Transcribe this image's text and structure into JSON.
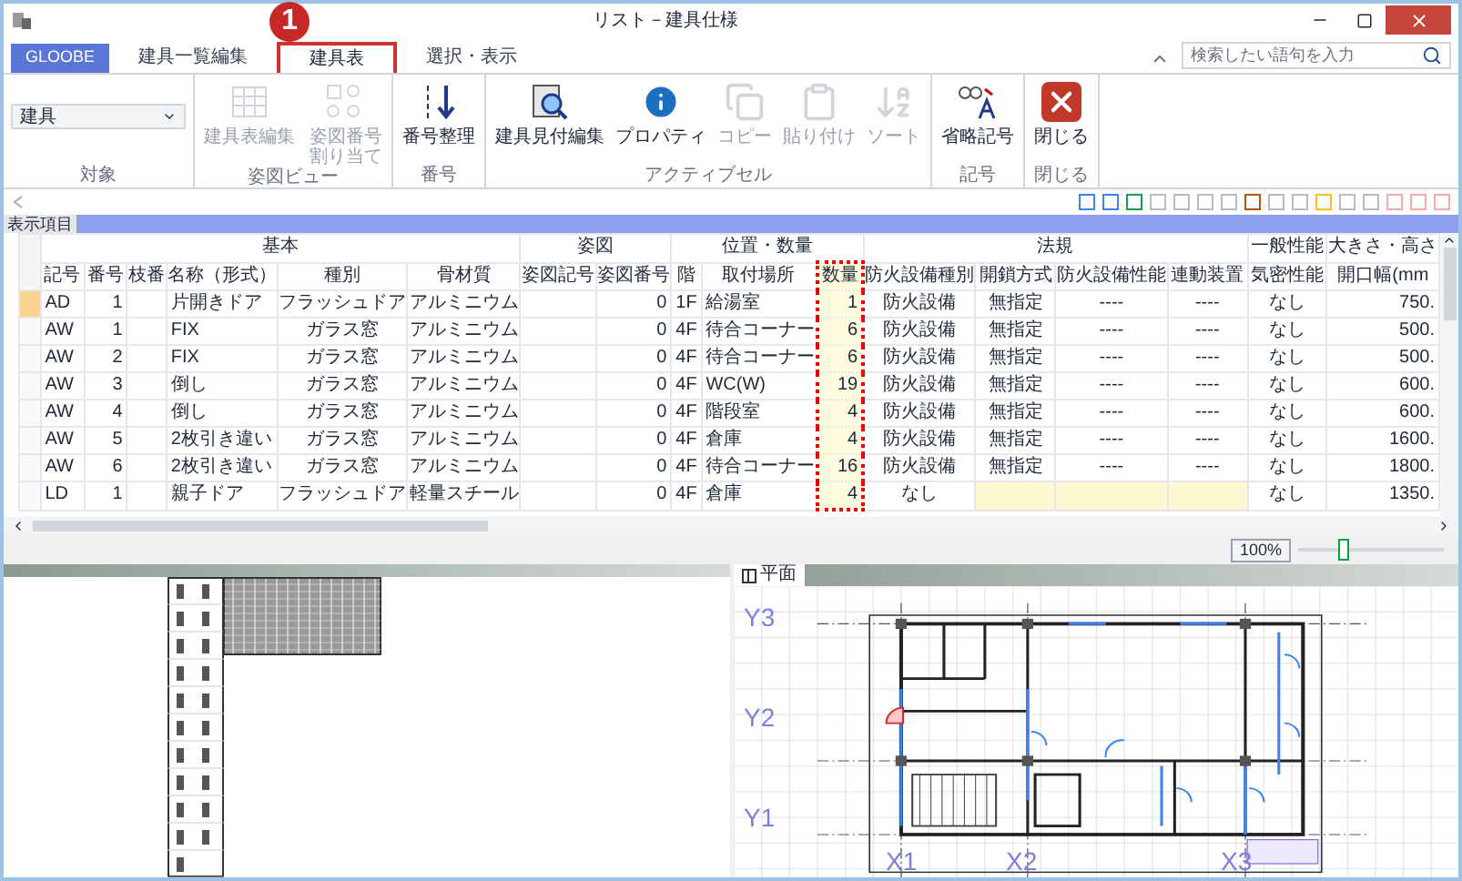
{
  "window": {
    "title": "リスト－建具仕様"
  },
  "app_button": {
    "label": "GLOOBE"
  },
  "tabs": [
    {
      "label": "建具一覧編集",
      "selected": false
    },
    {
      "label": "建具表",
      "selected": true,
      "callout": "1"
    },
    {
      "label": "選択・表示",
      "selected": false
    }
  ],
  "search": {
    "placeholder": "検索したい語句を入力"
  },
  "ribbon_groups": [
    {
      "title": "対象",
      "items": [
        {
          "kind": "dropdown",
          "value": "建具"
        }
      ]
    },
    {
      "title": "姿図ビュー",
      "items": [
        {
          "kind": "button",
          "label": "建具表編集",
          "disabled": true
        },
        {
          "kind": "button",
          "label": "姿図番号割り当て",
          "disabled": true
        }
      ]
    },
    {
      "title": "番号",
      "items": [
        {
          "kind": "button",
          "label": "番号整理",
          "disabled": false
        }
      ]
    },
    {
      "title": "アクティブセル",
      "items": [
        {
          "kind": "button",
          "label": "建具見付編集",
          "disabled": false
        },
        {
          "kind": "button",
          "label": "プロパティ",
          "disabled": false
        },
        {
          "kind": "button",
          "label": "コピー",
          "disabled": true
        },
        {
          "kind": "button",
          "label": "貼り付け",
          "disabled": true
        },
        {
          "kind": "button",
          "label": "ソート",
          "disabled": true
        }
      ]
    },
    {
      "title": "記号",
      "items": [
        {
          "kind": "button",
          "label": "省略記号",
          "disabled": false
        }
      ]
    },
    {
      "title": "閉じる",
      "items": [
        {
          "kind": "button",
          "label": "閉じる",
          "disabled": false
        }
      ]
    }
  ],
  "panel_header": "表示項目",
  "table": {
    "column_groups": [
      {
        "label": "基本",
        "columns": [
          {
            "label": "記号",
            "marked": false
          },
          {
            "label": "番号",
            "marked": false
          },
          {
            "label": "枝番",
            "marked": false
          },
          {
            "label": "名称（形式）",
            "marked": false
          },
          {
            "label": "種別",
            "marked": false
          },
          {
            "label": "骨材質",
            "marked": false
          }
        ]
      },
      {
        "label": "姿図",
        "columns": [
          {
            "label": "姿図記号",
            "marked": false
          },
          {
            "label": "姿図番号",
            "marked": false
          }
        ]
      },
      {
        "label": "位置・数量",
        "columns": [
          {
            "label": "階",
            "marked": false
          },
          {
            "label": "取付場所",
            "marked": false
          },
          {
            "label": "数量",
            "marked": true
          }
        ]
      },
      {
        "label": "法規",
        "columns": [
          {
            "label": "防火設備種別",
            "marked": false
          },
          {
            "label": "開鎖方式",
            "marked": false
          },
          {
            "label": "防火設備性能",
            "marked": false
          },
          {
            "label": "連動装置",
            "marked": false
          }
        ]
      },
      {
        "label": "一般性能",
        "columns": [
          {
            "label": "気密性能",
            "marked": false
          }
        ]
      },
      {
        "label": "大きさ・高さ",
        "columns": [
          {
            "label": "開口幅(mm",
            "marked": false
          }
        ]
      }
    ],
    "rows": [
      {
        "selected": true,
        "cells": [
          "AD",
          "1",
          null,
          "片開きドア",
          "フラッシュドア",
          "アルミニウム",
          null,
          "0",
          "1F",
          "給湯室",
          "1",
          "防火設備",
          "無指定",
          "----",
          "----",
          "なし",
          "750."
        ]
      },
      {
        "selected": false,
        "cells": [
          "AW",
          "1",
          null,
          "FIX",
          "ガラス窓",
          "アルミニウム",
          null,
          "0",
          "4F",
          "待合コーナー",
          "6",
          "防火設備",
          "無指定",
          "----",
          "----",
          "なし",
          "500."
        ]
      },
      {
        "selected": false,
        "cells": [
          "AW",
          "2",
          null,
          "FIX",
          "ガラス窓",
          "アルミニウム",
          null,
          "0",
          "4F",
          "待合コーナー",
          "6",
          "防火設備",
          "無指定",
          "----",
          "----",
          "なし",
          "500."
        ]
      },
      {
        "selected": false,
        "cells": [
          "AW",
          "3",
          null,
          "倒し",
          "ガラス窓",
          "アルミニウム",
          null,
          "0",
          "4F",
          "WC(W)",
          "19",
          "防火設備",
          "無指定",
          "----",
          "----",
          "なし",
          "600."
        ]
      },
      {
        "selected": false,
        "cells": [
          "AW",
          "4",
          null,
          "倒し",
          "ガラス窓",
          "アルミニウム",
          null,
          "0",
          "4F",
          "階段室",
          "4",
          "防火設備",
          "無指定",
          "----",
          "----",
          "なし",
          "600."
        ]
      },
      {
        "selected": false,
        "cells": [
          "AW",
          "5",
          null,
          "2枚引き違い",
          "ガラス窓",
          "アルミニウム",
          null,
          "0",
          "4F",
          "倉庫",
          "4",
          "防火設備",
          "無指定",
          "----",
          "----",
          "なし",
          "1600."
        ]
      },
      {
        "selected": false,
        "cells": [
          "AW",
          "6",
          null,
          "2枚引き違い",
          "ガラス窓",
          "アルミニウム",
          null,
          "0",
          "4F",
          "待合コーナー",
          "16",
          "防火設備",
          "無指定",
          "----",
          "----",
          "なし",
          "1800."
        ]
      },
      {
        "selected": false,
        "cells": [
          "LD",
          "1",
          null,
          "親子ドア",
          "フラッシュドア",
          "軽量スチール",
          null,
          "0",
          "4F",
          "倉庫",
          "4",
          "なし",
          {
            "shaded": true
          },
          {
            "shaded": true
          },
          {
            "shaded": true
          },
          "なし",
          "1350."
        ]
      }
    ]
  },
  "zoom": {
    "label": "100%",
    "level": 0.3
  },
  "plan_view": {
    "tab": "平面",
    "row_axes": [
      "Y3",
      "Y2",
      "Y1"
    ],
    "column_axes": [
      "X1",
      "X2",
      "X3"
    ]
  }
}
